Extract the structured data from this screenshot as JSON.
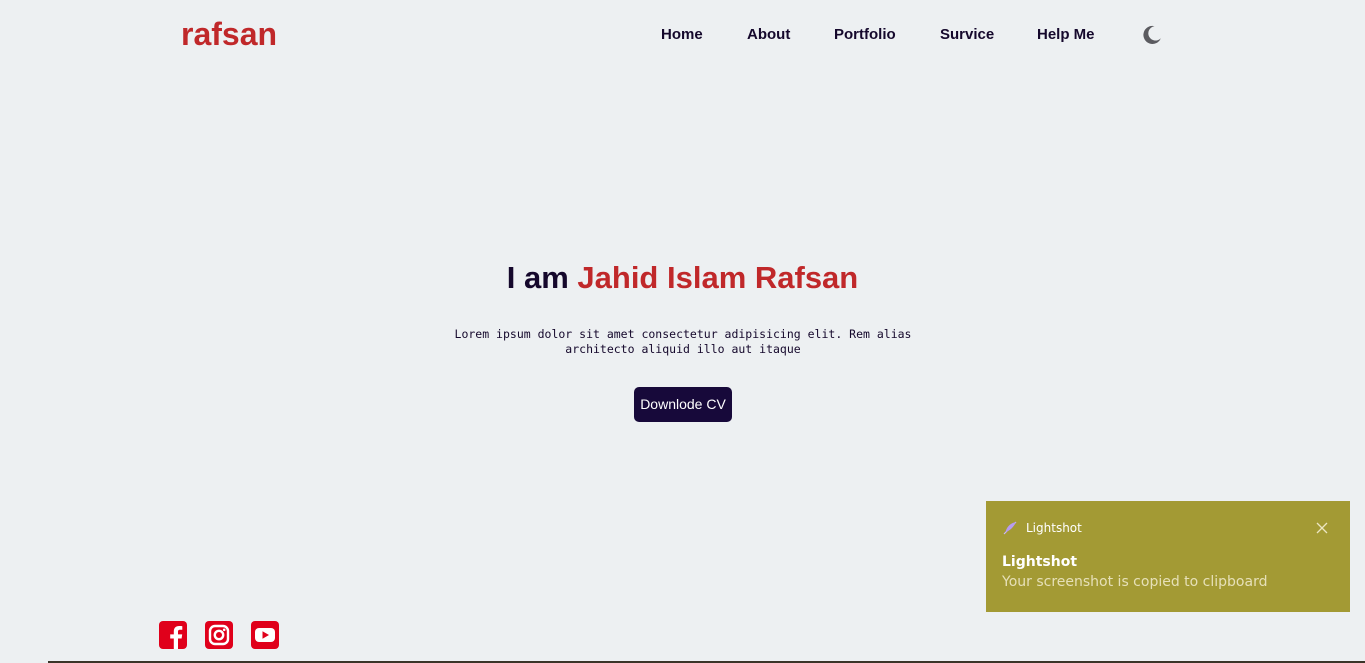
{
  "header": {
    "logo": "rafsan",
    "nav": [
      "Home",
      "About",
      "Portfolio",
      "Survice",
      "Help Me"
    ],
    "theme_icon": "moon-icon"
  },
  "hero": {
    "greeting": "I am ",
    "name": "Jahid Islam Rafsan",
    "description": "Lorem ipsum dolor sit amet consectetur adipisicing elit. Rem alias architecto aliquid illo aut itaque",
    "cv_button": "Downlode CV"
  },
  "social": {
    "icons": [
      "facebook-icon",
      "instagram-icon",
      "youtube-icon"
    ],
    "color": "#e0001b"
  },
  "toast": {
    "app_name": "Lightshot",
    "title": "Lightshot",
    "message": "Your screenshot is copied to clipboard",
    "app_icon": "feather-icon",
    "close_icon": "close-icon"
  },
  "colors": {
    "background": "#edf0f2",
    "accent": "#c0282a",
    "text_dark": "#15082c",
    "button": "#17093a",
    "toast_bg": "#a39a34"
  }
}
